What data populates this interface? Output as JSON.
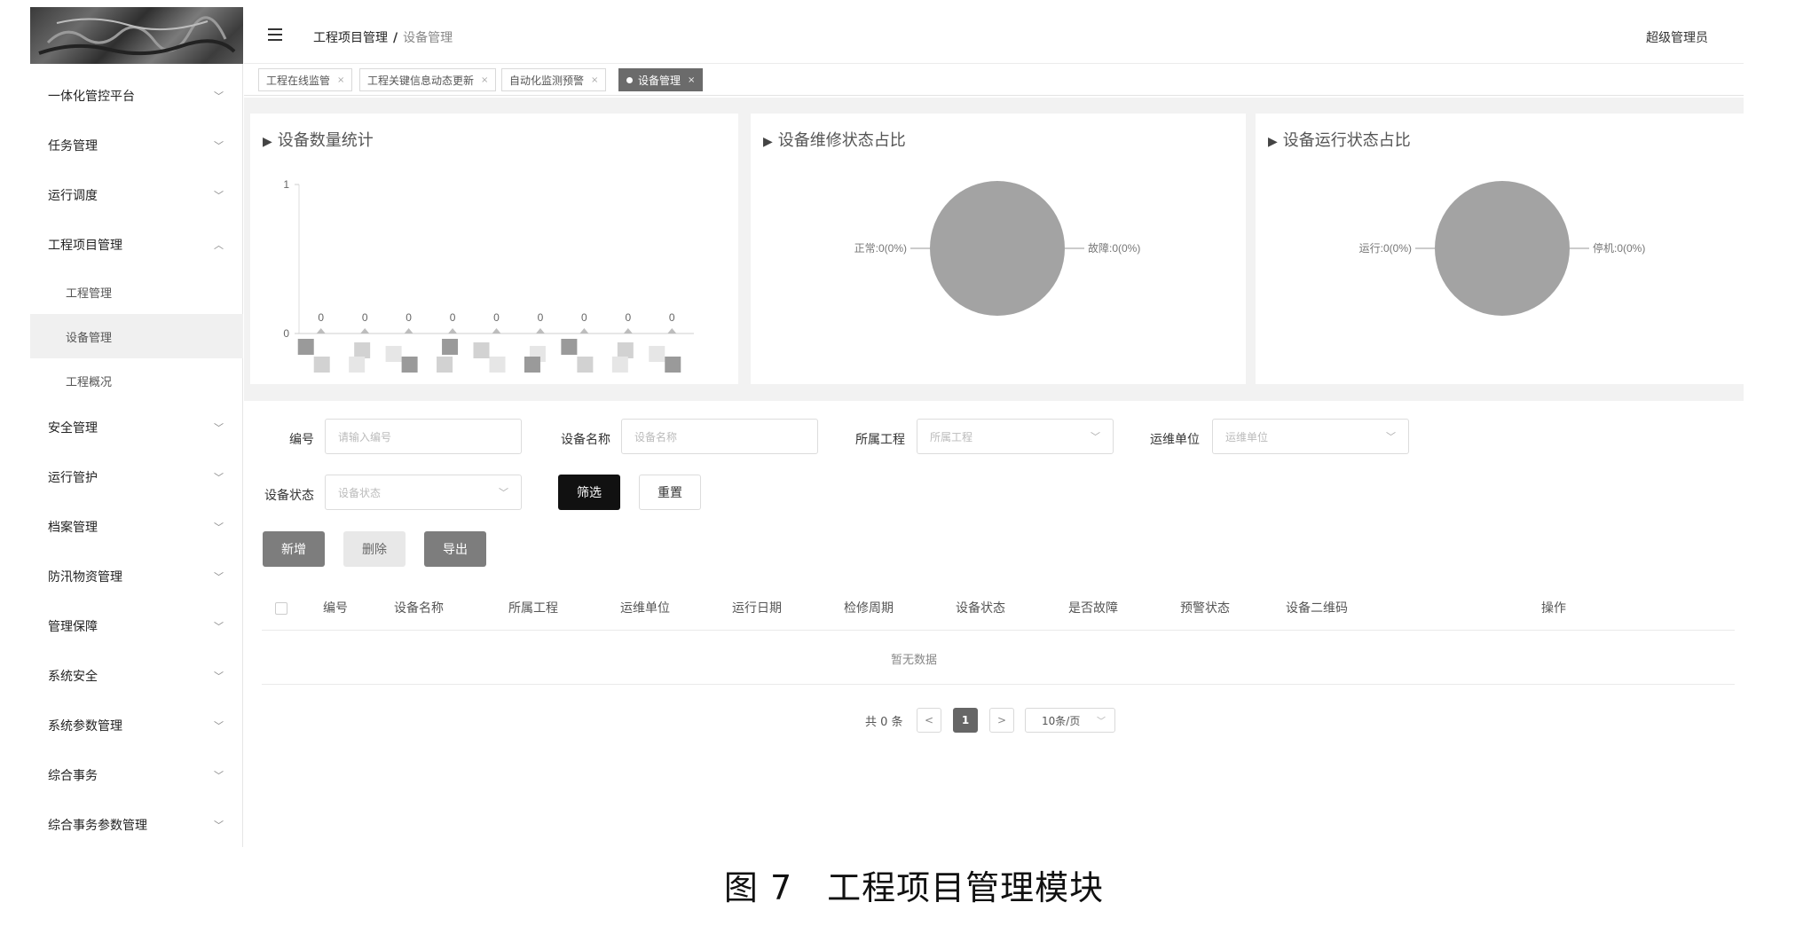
{
  "sidebar": {
    "items": [
      {
        "label": "一体化管控平台",
        "expanded": false
      },
      {
        "label": "任务管理",
        "expanded": false
      },
      {
        "label": "运行调度",
        "expanded": false
      },
      {
        "label": "工程项目管理",
        "expanded": true
      },
      {
        "label": "安全管理",
        "expanded": false
      },
      {
        "label": "运行管护",
        "expanded": false
      },
      {
        "label": "档案管理",
        "expanded": false
      },
      {
        "label": "防汛物资管理",
        "expanded": false
      },
      {
        "label": "管理保障",
        "expanded": false
      },
      {
        "label": "系统安全",
        "expanded": false
      },
      {
        "label": "系统参数管理",
        "expanded": false
      },
      {
        "label": "综合事务",
        "expanded": false
      },
      {
        "label": "综合事务参数管理",
        "expanded": false
      }
    ],
    "submenu": [
      {
        "label": "工程管理",
        "active": false
      },
      {
        "label": "设备管理",
        "active": true
      },
      {
        "label": "工程概况",
        "active": false
      }
    ]
  },
  "header": {
    "breadcrumb": [
      "工程项目管理",
      "设备管理"
    ],
    "separator": "/",
    "user": "超级管理员"
  },
  "tabs": [
    {
      "label": "工程在线监管",
      "active": false
    },
    {
      "label": "工程关键信息动态更新",
      "active": false
    },
    {
      "label": "自动化监测预警",
      "active": false
    },
    {
      "label": "设备管理",
      "active": true
    }
  ],
  "tab_close": "×",
  "tab_close_inactive": "×",
  "cards": {
    "count_title": "设备数量统计",
    "repair_title": "设备维修状态占比",
    "run_title": "设备运行状态占比"
  },
  "chart_data": [
    {
      "type": "bar",
      "title": "设备数量统计",
      "ylim": [
        0,
        1
      ],
      "yticks": [
        "0",
        "1"
      ],
      "values": [
        0,
        0,
        0,
        0,
        0,
        0,
        0,
        0,
        0
      ],
      "data_labels": [
        "0",
        "0",
        "0",
        "0",
        "0",
        "0",
        "0",
        "0",
        "0"
      ]
    },
    {
      "type": "pie",
      "title": "设备维修状态占比",
      "slices": [
        {
          "label": "正常:0(0%)",
          "value": 0
        },
        {
          "label": "故障:0(0%)",
          "value": 0
        }
      ]
    },
    {
      "type": "pie",
      "title": "设备运行状态占比",
      "slices": [
        {
          "label": "运行:0(0%)",
          "value": 0
        },
        {
          "label": "停机:0(0%)",
          "value": 0
        }
      ]
    }
  ],
  "filters": {
    "code_label": "编号",
    "code_placeholder": "请输入编号",
    "name_label": "设备名称",
    "name_placeholder": "设备名称",
    "project_label": "所属工程",
    "project_placeholder": "所属工程",
    "unit_label": "运维单位",
    "unit_placeholder": "运维单位",
    "status_label": "设备状态",
    "status_placeholder": "设备状态",
    "filter_button": "筛选",
    "reset_button": "重置"
  },
  "actions": {
    "add": "新增",
    "delete": "删除",
    "export": "导出"
  },
  "table": {
    "columns": [
      "编号",
      "设备名称",
      "所属工程",
      "运维单位",
      "运行日期",
      "检修周期",
      "设备状态",
      "是否故障",
      "预警状态",
      "设备二维码",
      "操作"
    ],
    "empty_text": "暂无数据"
  },
  "pagination": {
    "total": "共 0 条",
    "prev": "<",
    "current": "1",
    "next": ">",
    "page_size": "10条/页"
  },
  "caption": "图 7　工程项目管理模块",
  "colors": {
    "pie_fill": "#a3a3a3",
    "active_tab": "#6b6b6b",
    "filter_button": "#111111"
  }
}
